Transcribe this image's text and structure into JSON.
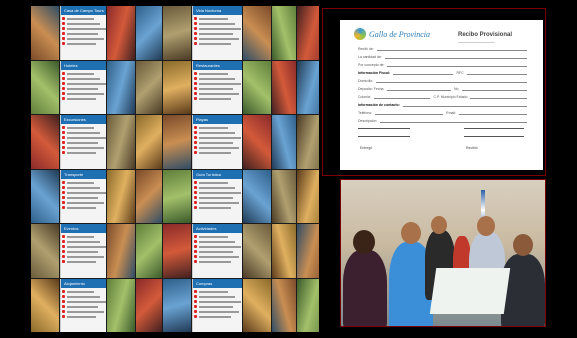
{
  "collage": {
    "card_titles": [
      "Casa de Campo Tours",
      "Vida Nocturna",
      "Hoteles",
      "Restaurantes",
      "Excursiones",
      "Playas",
      "Transporte",
      "Guía Turística",
      "Eventos",
      "Actividades",
      "Alojamiento",
      "Compras"
    ]
  },
  "receipt": {
    "logo_text": "Gallo de Provincia",
    "title": "Recibo Provisional ___________",
    "fields": [
      {
        "label": "Recibí de:",
        "bold": false
      },
      {
        "label": "La cantidad de:",
        "bold": false
      },
      {
        "label": "Por concepto de:",
        "bold": false
      },
      {
        "label": "Información Fiscal:",
        "bold": true,
        "extra": "RFC"
      },
      {
        "label": "Domicilio:",
        "bold": false
      },
      {
        "label": "Deposito:  Fecha",
        "bold": false,
        "extra": "No."
      },
      {
        "label": "Colonia:",
        "bold": false,
        "extra": "C.P.   Municipio   Estado"
      },
      {
        "label": "Información de contacto:",
        "bold": true
      },
      {
        "label": "Teléfono:",
        "bold": false,
        "extra": "Email:"
      },
      {
        "label": "Descripción:",
        "bold": false
      }
    ],
    "sign_left": "Entregó",
    "sign_right": "Recibió"
  },
  "photo": {
    "description_alt": "Group at table"
  }
}
